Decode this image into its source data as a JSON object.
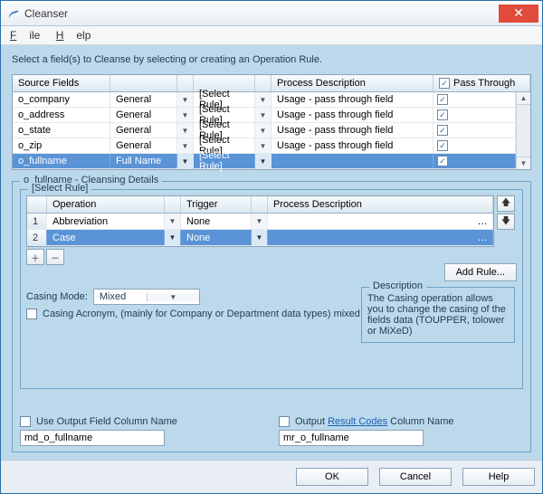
{
  "window": {
    "title": "Cleanser"
  },
  "menu": {
    "file": "File",
    "help": "Help"
  },
  "instruction": "Select a field(s) to Cleanse by selecting or creating an Operation Rule.",
  "source_grid": {
    "headers": {
      "source": "Source Fields",
      "process": "Process Description",
      "pass": "Pass Through"
    },
    "rule_placeholder": "[Select Rule]",
    "rows": [
      {
        "name": "o_company",
        "type": "General",
        "proc": "Usage - pass through field",
        "pass": true,
        "selected": false
      },
      {
        "name": "o_address",
        "type": "General",
        "proc": "Usage - pass through field",
        "pass": true,
        "selected": false
      },
      {
        "name": "o_state",
        "type": "General",
        "proc": "Usage - pass through field",
        "pass": true,
        "selected": false
      },
      {
        "name": "o_zip",
        "type": "General",
        "proc": "Usage - pass through field",
        "pass": true,
        "selected": false
      },
      {
        "name": "o_fullname",
        "type": "Full Name",
        "proc": "",
        "pass": true,
        "selected": true
      }
    ]
  },
  "details": {
    "title": "o_fullname - Cleansing Details",
    "sub_title": "[Select Rule]",
    "op_headers": {
      "operation": "Operation",
      "trigger": "Trigger",
      "process": "Process Description"
    },
    "op_rows": [
      {
        "n": "1",
        "op": "Abbreviation",
        "trigger": "None",
        "proc": "",
        "selected": false
      },
      {
        "n": "2",
        "op": "Case",
        "trigger": "None",
        "proc": "",
        "selected": true
      }
    ],
    "casing_label": "Casing Mode:",
    "casing_value": "Mixed",
    "acronym_label": "Casing Acronym, (mainly for Company or Department data types) mixed casing",
    "add_rule": "Add Rule...",
    "desc_title": "Description",
    "desc_body": "The Casing operation allows you to change the casing of the fields data (TOUPPER, tolower or MiXeD)"
  },
  "output": {
    "use_out_label": "Use Output Field Column Name",
    "use_out_value": "md_o_fullname",
    "codes_label_pre": "Output ",
    "codes_link": "Result Codes",
    "codes_label_post": " Column Name",
    "codes_value": "mr_o_fullname"
  },
  "footer": {
    "ok": "OK",
    "cancel": "Cancel",
    "help": "Help"
  }
}
